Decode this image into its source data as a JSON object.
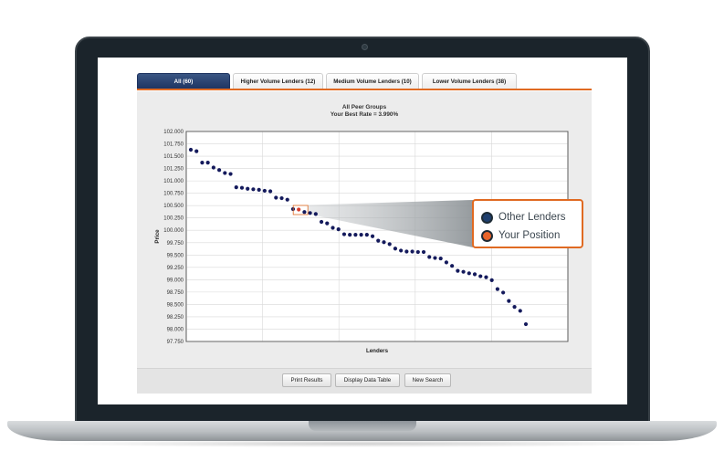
{
  "tabs": [
    {
      "label": "All (60)",
      "active": true
    },
    {
      "label": "Higher Volume Lenders (12)",
      "active": false
    },
    {
      "label": "Medium Volume Lenders (10)",
      "active": false
    },
    {
      "label": "Lower Volume Lenders (38)",
      "active": false
    }
  ],
  "buttons": {
    "print": "Print Results",
    "display_table": "Display Data Table",
    "new_search": "New Search"
  },
  "legend": {
    "other": {
      "label": "Other Lenders",
      "color": "#1f3f6e"
    },
    "yours": {
      "label": "Your Position",
      "color": "#e8642a"
    }
  },
  "colors": {
    "accent": "#e06a22",
    "tab_active": "#1d3360",
    "dot": "#141a5c",
    "highlight": "#d93b2a"
  },
  "chart_data": {
    "type": "scatter",
    "title": "All Peer Groups",
    "subtitle": "Your Best Rate = 3.990%",
    "xlabel": "Lenders",
    "ylabel": "Price",
    "ylim": [
      97.75,
      102.0
    ],
    "yticks": [
      "102.000",
      "101.750",
      "101.500",
      "101.250",
      "101.000",
      "100.750",
      "100.500",
      "100.250",
      "100.000",
      "99.750",
      "99.500",
      "99.250",
      "99.000",
      "98.750",
      "98.500",
      "98.250",
      "98.000",
      "97.750"
    ],
    "grid": true,
    "x_gridlines": 5,
    "highlight_index": 19,
    "y": [
      101.63,
      101.6,
      101.37,
      101.37,
      101.27,
      101.22,
      101.16,
      101.14,
      100.87,
      100.86,
      100.84,
      100.83,
      100.82,
      100.8,
      100.79,
      100.66,
      100.65,
      100.62,
      100.43,
      100.42,
      100.37,
      100.35,
      100.33,
      100.17,
      100.14,
      100.05,
      100.02,
      99.92,
      99.91,
      99.91,
      99.91,
      99.91,
      99.88,
      99.79,
      99.76,
      99.72,
      99.63,
      99.59,
      99.57,
      99.57,
      99.56,
      99.56,
      99.46,
      99.44,
      99.43,
      99.35,
      99.28,
      99.18,
      99.16,
      99.13,
      99.11,
      99.07,
      99.05,
      98.99,
      98.81,
      98.74,
      98.57,
      98.45,
      98.37,
      98.1
    ]
  }
}
